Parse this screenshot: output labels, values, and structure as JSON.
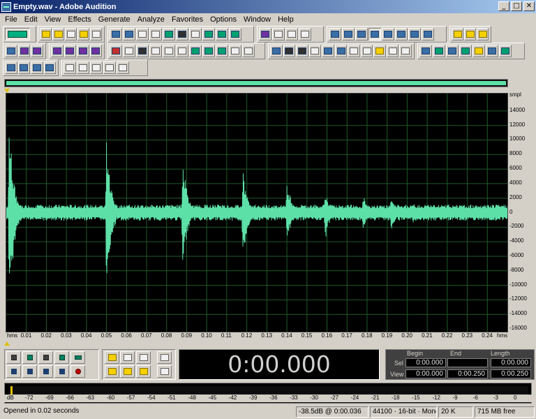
{
  "window": {
    "title": "Empty.wav - Adobe Audition",
    "min": "_",
    "max": "□",
    "close": "✕"
  },
  "menu": [
    "File",
    "Edit",
    "View",
    "Effects",
    "Generate",
    "Analyze",
    "Favorites",
    "Options",
    "Window",
    "Help"
  ],
  "waveform": {
    "color": "#5de0a8",
    "grid_color": "#1f5a2a",
    "vertical_unit": "smpl",
    "vertical_ticks": [
      "14000",
      "12000",
      "10000",
      "8000",
      "6000",
      "4000",
      "2000",
      "0",
      "-2000",
      "-4000",
      "-6000",
      "-8000",
      "-10000",
      "-12000",
      "-14000",
      "-16000"
    ],
    "horizontal_unit": "hms",
    "horizontal_ticks": [
      "0.01",
      "0.02",
      "0.03",
      "0.04",
      "0.05",
      "0.06",
      "0.07",
      "0.08",
      "0.09",
      "0.10",
      "0.11",
      "0.12",
      "0.13",
      "0.14",
      "0.15",
      "0.16",
      "0.17",
      "0.18",
      "0.19",
      "0.20",
      "0.21",
      "0.22",
      "0.23",
      "0.24"
    ],
    "y_range": [
      -16000,
      16000
    ],
    "x_range_seconds": [
      0,
      0.25
    ],
    "transients": [
      {
        "t": 0.0015,
        "peak": 13000,
        "trough": -15000
      },
      {
        "t": 0.05,
        "peak": 11000,
        "trough": -12000
      },
      {
        "t": 0.088,
        "peak": 8200,
        "trough": -8500
      },
      {
        "t": 0.118,
        "peak": 6300,
        "trough": -7500
      },
      {
        "t": 0.14,
        "peak": 4800,
        "trough": -4800
      },
      {
        "t": 0.159,
        "peak": 3500,
        "trough": -4200
      },
      {
        "t": 0.178,
        "peak": 2800,
        "trough": -2600
      },
      {
        "t": 0.192,
        "peak": 2600,
        "trough": -2800
      },
      {
        "t": 0.203,
        "peak": 1600,
        "trough": -1500
      },
      {
        "t": 0.212,
        "peak": 1200,
        "trough": -1100
      },
      {
        "t": 0.22,
        "peak": 900,
        "trough": -900
      }
    ]
  },
  "time_display": "0:00.000",
  "selection": {
    "headers": {
      "begin": "Begin",
      "end": "End",
      "length": "Length"
    },
    "rows": [
      {
        "label": "Sel",
        "begin": "0:00.000",
        "end": "",
        "length": "0:00.000"
      },
      {
        "label": "View",
        "begin": "0:00.000",
        "end": "0:00.250",
        "length": "0:00.250"
      }
    ]
  },
  "level_meter": {
    "unit": "dB",
    "ticks": [
      "-72",
      "-69",
      "-66",
      "-63",
      "-60",
      "-57",
      "-54",
      "-51",
      "-48",
      "-45",
      "-42",
      "-39",
      "-36",
      "-33",
      "-30",
      "-27",
      "-24",
      "-21",
      "-18",
      "-15",
      "-12",
      "-9",
      "-6",
      "-3",
      "0"
    ]
  },
  "status": {
    "message": "Opened in 0.02 seconds",
    "cursor": "-38.5dB @  0:00.036",
    "format": "44100 · 16-bit · Mono",
    "file_size": "20 K",
    "free_space": "715 MB free"
  }
}
